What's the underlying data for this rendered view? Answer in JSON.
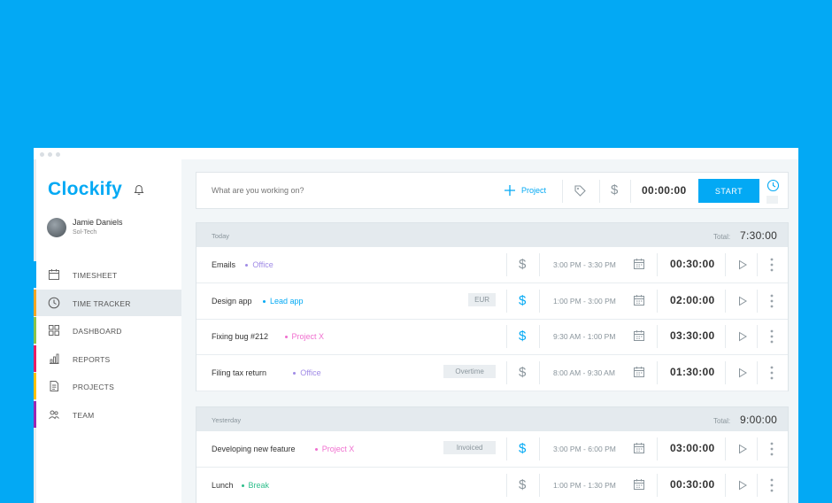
{
  "app": {
    "logo": "Clockify",
    "user": {
      "name": "Jamie Daniels",
      "company": "Sol-Tech"
    }
  },
  "sidebar": {
    "items": [
      {
        "label": "TIMESHEET",
        "icon": "calendar-icon",
        "color": "#03A9F4",
        "active": false
      },
      {
        "label": "TIME TRACKER",
        "icon": "clock-icon",
        "color": "#F4A623",
        "active": true
      },
      {
        "label": "DASHBOARD",
        "icon": "dashboard-grid-icon",
        "color": "#8BC34A",
        "active": false
      },
      {
        "label": "REPORTS",
        "icon": "bar-chart-icon",
        "color": "#E91E63",
        "active": false
      },
      {
        "label": "PROJECTS",
        "icon": "document-icon",
        "color": "#FFC107",
        "active": false
      },
      {
        "label": "TEAM",
        "icon": "team-icon",
        "color": "#9C27B0",
        "active": false
      }
    ]
  },
  "entry": {
    "placeholder": "What are you working on?",
    "project_label": "Project",
    "timer": "00:00:00",
    "start_label": "START"
  },
  "groups": [
    {
      "date": "Today",
      "total_label": "Total:",
      "total": "7:30:00",
      "entries": [
        {
          "description": "Emails",
          "project": "Office",
          "project_color": "#A08BE6",
          "tag": "",
          "billable": false,
          "range": "3:00 PM - 3:30 PM",
          "duration": "00:30:00"
        },
        {
          "description": "Design app",
          "project": "Lead app",
          "project_color": "#03A9F4",
          "tag": "EUR",
          "billable": true,
          "range": "1:00 PM - 3:00 PM",
          "duration": "02:00:00"
        },
        {
          "description": "Fixing bug #212",
          "project": "Project X",
          "project_color": "#F06ECF",
          "tag": "",
          "billable": true,
          "range": "9:30 AM - 1:00 PM",
          "duration": "03:30:00"
        },
        {
          "description": "Filing tax return",
          "project": "Office",
          "project_color": "#A08BE6",
          "tag": "Overtime",
          "billable": false,
          "range": "8:00 AM - 9:30 AM",
          "duration": "01:30:00"
        }
      ]
    },
    {
      "date": "Yesterday",
      "total_label": "Total:",
      "total": "9:00:00",
      "entries": [
        {
          "description": "Developing new feature",
          "project": "Project X",
          "project_color": "#F06ECF",
          "tag": "Invoiced",
          "billable": true,
          "range": "3:00 PM - 6:00 PM",
          "duration": "03:00:00"
        },
        {
          "description": "Lunch",
          "project": "Break",
          "project_color": "#2DBE8B",
          "tag": "",
          "billable": false,
          "range": "1:00 PM - 1:30 PM",
          "duration": "00:30:00"
        }
      ]
    }
  ],
  "colors": {
    "brand": "#03A9F4",
    "billable_on": "#03A9F4",
    "billable_off": "#8A959C"
  }
}
